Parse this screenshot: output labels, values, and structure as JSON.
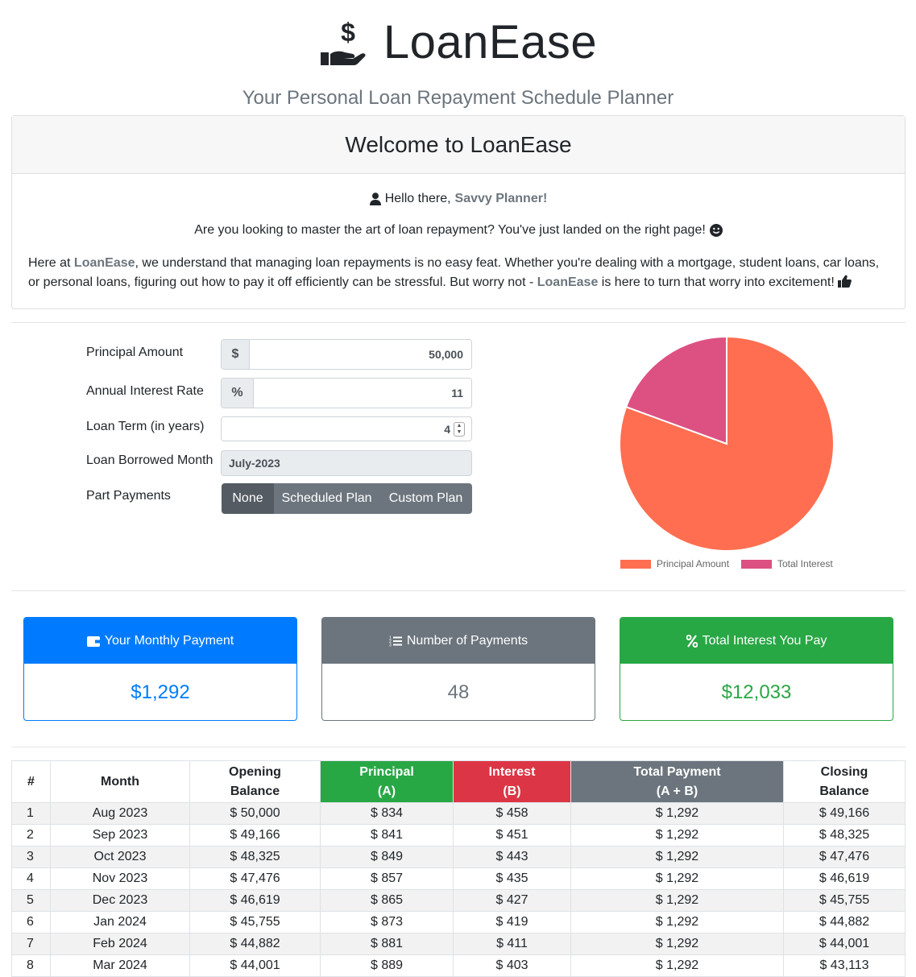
{
  "brand": {
    "name": "LoanEase",
    "tagline": "Your Personal Loan Repayment Schedule Planner",
    "icon": "hand-holding-dollar-icon"
  },
  "welcome": {
    "title": "Welcome to LoanEase",
    "greeting_prefix": "Hello there,",
    "greeting_name": "Savvy Planner!",
    "question": "Are you looking to master the art of loan repayment? You've just landed on the right page!",
    "para_1": "Here at",
    "para_brand": "LoanEase",
    "para_2": ", we understand that managing loan repayments is no easy feat. Whether you're dealing with a mortgage, student loans, car loans, or personal loans, figuring out how to pay it off efficiently can be stressful. But worry not -",
    "para_brand_2": "LoanEase",
    "para_3": "is here to turn that worry into excitement!"
  },
  "form": {
    "principal_label": "Principal Amount",
    "principal_addon": "$",
    "principal_value": "50,000",
    "rate_label": "Annual Interest Rate",
    "rate_addon": "%",
    "rate_value": "11",
    "term_label": "Loan Term (in years)",
    "term_value": "4",
    "month_label": "Loan Borrowed Month",
    "month_value": "July-2023",
    "part_label": "Part Payments",
    "part_options": [
      "None",
      "Scheduled Plan",
      "Custom Plan"
    ],
    "part_selected": "None"
  },
  "chart_data": {
    "type": "pie",
    "categories": [
      "Principal Amount",
      "Total Interest"
    ],
    "values": [
      50000,
      12033
    ],
    "colors": [
      "#ff6e50",
      "#dd5182"
    ],
    "legend_position": "bottom"
  },
  "stats": {
    "monthly": {
      "label": "Your Monthly Payment",
      "value": "$1,292",
      "color": "#007bff",
      "icon": "wallet-icon"
    },
    "count": {
      "label": "Number of Payments",
      "value": "48",
      "color": "#6c757d",
      "icon": "list-icon"
    },
    "interest": {
      "label": "Total Interest You Pay",
      "value": "$12,033",
      "color": "#28a745",
      "icon": "percent-icon"
    }
  },
  "table": {
    "headers": {
      "num": "#",
      "month": "Month",
      "opening_1": "Opening",
      "opening_2": "Balance",
      "principal_1": "Principal",
      "principal_2": "(A)",
      "interest_1": "Interest",
      "interest_2": "(B)",
      "total_1": "Total Payment",
      "total_2": "(A + B)",
      "closing_1": "Closing",
      "closing_2": "Balance"
    },
    "rows": [
      [
        "1",
        "Aug 2023",
        "$ 50,000",
        "$ 834",
        "$ 458",
        "$ 1,292",
        "$ 49,166"
      ],
      [
        "2",
        "Sep 2023",
        "$ 49,166",
        "$ 841",
        "$ 451",
        "$ 1,292",
        "$ 48,325"
      ],
      [
        "3",
        "Oct 2023",
        "$ 48,325",
        "$ 849",
        "$ 443",
        "$ 1,292",
        "$ 47,476"
      ],
      [
        "4",
        "Nov 2023",
        "$ 47,476",
        "$ 857",
        "$ 435",
        "$ 1,292",
        "$ 46,619"
      ],
      [
        "5",
        "Dec 2023",
        "$ 46,619",
        "$ 865",
        "$ 427",
        "$ 1,292",
        "$ 45,755"
      ],
      [
        "6",
        "Jan 2024",
        "$ 45,755",
        "$ 873",
        "$ 419",
        "$ 1,292",
        "$ 44,882"
      ],
      [
        "7",
        "Feb 2024",
        "$ 44,882",
        "$ 881",
        "$ 411",
        "$ 1,292",
        "$ 44,001"
      ],
      [
        "8",
        "Mar 2024",
        "$ 44,001",
        "$ 889",
        "$ 403",
        "$ 1,292",
        "$ 43,113"
      ]
    ]
  }
}
